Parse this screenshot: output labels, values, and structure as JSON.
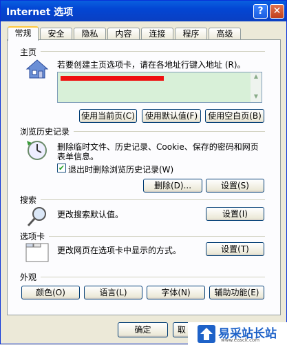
{
  "window": {
    "title": "Internet 选项",
    "help_label": "?",
    "close_label": "✕"
  },
  "tabs": [
    "常规",
    "安全",
    "隐私",
    "内容",
    "连接",
    "程序",
    "高级"
  ],
  "home": {
    "section": "主页",
    "description": "若要创建主页选项卡，请在各地址行键入地址 (R)。",
    "buttons": [
      "使用当前页(C)",
      "使用默认值(F)",
      "使用空白页(B)"
    ]
  },
  "history": {
    "section": "浏览历史记录",
    "description_line1": "删除临时文件、历史记录、Cookie、保存的密码和网页",
    "description_line2": "表单信息。",
    "checkbox_label": "退出时删除浏览历史记录(W)",
    "checkbox_checked": true,
    "delete_label": "删除(D)...",
    "settings_label": "设置(S)"
  },
  "search": {
    "section": "搜索",
    "description": "更改搜索默认值。",
    "settings_label": "设置(I)"
  },
  "tabs_section": {
    "section": "选项卡",
    "description": "更改网页在选项卡中显示的方式。",
    "settings_label": "设置(T)"
  },
  "appearance": {
    "section": "外观",
    "buttons": [
      "颜色(O)",
      "语言(L)",
      "字体(N)",
      "辅助功能(E)"
    ]
  },
  "footer": {
    "ok_label": "确定",
    "cancel_label": "取"
  },
  "watermark": {
    "text": "易采站长站",
    "url": "www.easck.com"
  },
  "icons": [
    "home-icon",
    "history-icon",
    "search-icon",
    "tabs-icon"
  ]
}
